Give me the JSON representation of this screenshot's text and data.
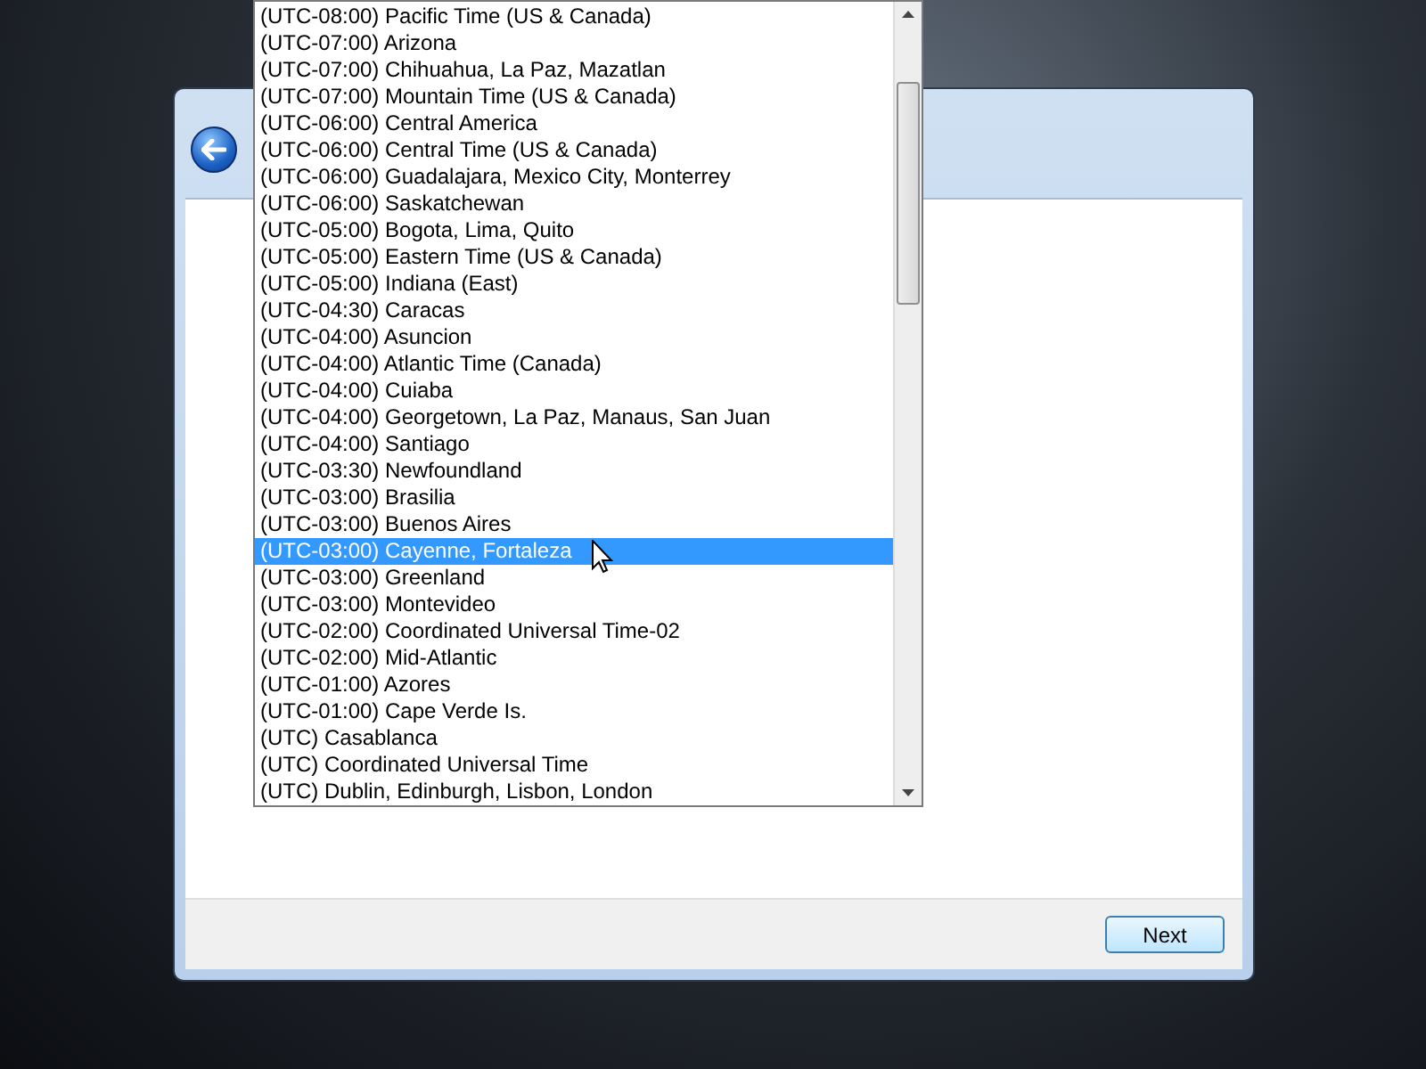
{
  "timezone_list": {
    "items": [
      {
        "label": "(UTC-08:00) Pacific Time (US & Canada)",
        "selected": false
      },
      {
        "label": "(UTC-07:00) Arizona",
        "selected": false
      },
      {
        "label": "(UTC-07:00) Chihuahua, La Paz, Mazatlan",
        "selected": false
      },
      {
        "label": "(UTC-07:00) Mountain Time (US & Canada)",
        "selected": false
      },
      {
        "label": "(UTC-06:00) Central America",
        "selected": false
      },
      {
        "label": "(UTC-06:00) Central Time (US & Canada)",
        "selected": false
      },
      {
        "label": "(UTC-06:00) Guadalajara, Mexico City, Monterrey",
        "selected": false
      },
      {
        "label": "(UTC-06:00) Saskatchewan",
        "selected": false
      },
      {
        "label": "(UTC-05:00) Bogota, Lima, Quito",
        "selected": false
      },
      {
        "label": "(UTC-05:00) Eastern Time (US & Canada)",
        "selected": false
      },
      {
        "label": "(UTC-05:00) Indiana (East)",
        "selected": false
      },
      {
        "label": "(UTC-04:30) Caracas",
        "selected": false
      },
      {
        "label": "(UTC-04:00) Asuncion",
        "selected": false
      },
      {
        "label": "(UTC-04:00) Atlantic Time (Canada)",
        "selected": false
      },
      {
        "label": "(UTC-04:00) Cuiaba",
        "selected": false
      },
      {
        "label": "(UTC-04:00) Georgetown, La Paz, Manaus, San Juan",
        "selected": false
      },
      {
        "label": "(UTC-04:00) Santiago",
        "selected": false
      },
      {
        "label": "(UTC-03:30) Newfoundland",
        "selected": false
      },
      {
        "label": "(UTC-03:00) Brasilia",
        "selected": false
      },
      {
        "label": "(UTC-03:00) Buenos Aires",
        "selected": false
      },
      {
        "label": "(UTC-03:00) Cayenne, Fortaleza",
        "selected": true
      },
      {
        "label": "(UTC-03:00) Greenland",
        "selected": false
      },
      {
        "label": "(UTC-03:00) Montevideo",
        "selected": false
      },
      {
        "label": "(UTC-02:00) Coordinated Universal Time-02",
        "selected": false
      },
      {
        "label": "(UTC-02:00) Mid-Atlantic",
        "selected": false
      },
      {
        "label": "(UTC-01:00) Azores",
        "selected": false
      },
      {
        "label": "(UTC-01:00) Cape Verde Is.",
        "selected": false
      },
      {
        "label": "(UTC) Casablanca",
        "selected": false
      },
      {
        "label": "(UTC) Coordinated Universal Time",
        "selected": false
      },
      {
        "label": "(UTC) Dublin, Edinburgh, Lisbon, London",
        "selected": false
      }
    ]
  },
  "buttons": {
    "next": "Next"
  }
}
